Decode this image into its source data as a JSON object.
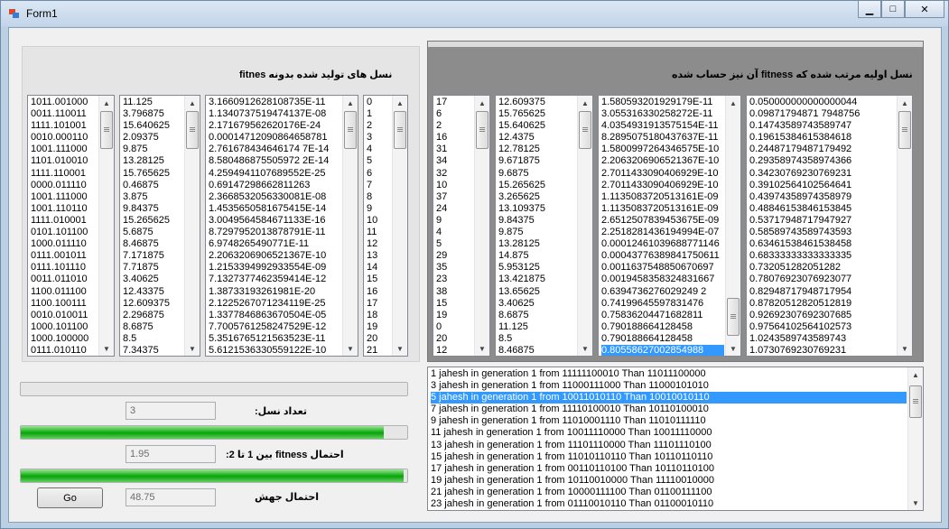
{
  "window": {
    "title": "Form1",
    "minimize_icon": "minimize-icon",
    "maximize_icon": "maximize-icon",
    "close_icon": "close-icon",
    "minimize_glyph": "▁",
    "maximize_glyph": "□",
    "close_glyph": "✕"
  },
  "left_panel": {
    "title": "نسل های تولید شده بدونه fitnes",
    "binaries": [
      "1011.001000",
      "0011.110011",
      "1111.101001",
      "0010.000110",
      "1001.111000",
      "1101.010010",
      "1111.110001",
      "0000.011110",
      "1001.111000",
      "1001.110110",
      "1111.010001",
      "0101.101100",
      "1000.011110",
      "0111.001011",
      "0111.101110",
      "0011.011010",
      "1100.011100",
      "1100.100111",
      "0010.010011",
      "1000.101100",
      "1000.100000",
      "0111.010110"
    ],
    "decimals": [
      "11.125",
      "3.796875",
      "15.640625",
      "2.09375",
      "9.875",
      "13.28125",
      "15.765625",
      "0.46875",
      "3.875",
      "9.84375",
      "15.265625",
      "5.6875",
      "8.46875",
      "7.171875",
      "7.71875",
      "3.40625",
      "12.43375",
      "12.609375",
      "2.296875",
      "8.6875",
      "8.5",
      "7.34375"
    ],
    "values": [
      "3.1660912628108735E-11",
      "1.1340737519474137E-08",
      "2.171679562620176E-24",
      "0.00014712090864658781",
      "2.761678434646174 7E-14",
      "8.580486875505972 2E-14",
      "4.2594941107689552E-25",
      "0.69147298662811263",
      "2.3668532056330081E-08",
      "1.4535650581675415E-14",
      "3.0049564584671133E-16",
      "8.7297952013878791E-11",
      "6.9748265490771E-11",
      "2.2063206906521367E-10",
      "1.2153394992933554E-09",
      "7.1327377462359414E-12",
      "1.38733193261981E-20",
      "2.1225267071234119E-25",
      "1.3377846863670504E-05",
      "7.7005761258247529E-12",
      "5.3516765121563523E-11",
      "5.6121536330559122E-10"
    ],
    "indices": [
      "0",
      "1",
      "2",
      "3",
      "4",
      "5",
      "6",
      "7",
      "8",
      "9",
      "10",
      "11",
      "12",
      "13",
      "14",
      "15",
      "16",
      "17",
      "18",
      "19",
      "20",
      "21"
    ]
  },
  "right_panel": {
    "title": "نسل اولیه مرتب شده که fitness آن نیز حساب شده",
    "indices": [
      "17",
      "6",
      "2",
      "16",
      "31",
      "34",
      "32",
      "10",
      "37",
      "24",
      "9",
      "4",
      "5",
      "29",
      "35",
      "23",
      "38",
      "15",
      "19",
      "0",
      "20",
      "12"
    ],
    "decimals": [
      "12.609375",
      "15.765625",
      "15.640625",
      "12.4375",
      "12.78125",
      "9.671875",
      "9.6875",
      "15.265625",
      "3.265625",
      "13.109375",
      "9.84375",
      "9.875",
      "13.28125",
      "14.875",
      "5.953125",
      "13.421875",
      "13.65625",
      "3.40625",
      "8.6875",
      "11.125",
      "8.5",
      "8.46875"
    ],
    "fitness": [
      "1.580593201929179E-11",
      "3.055316330258272E-11",
      "4.0354931913575154E-11",
      "8.2895075180437637E-11",
      "1.5800997264346575E-10",
      "2.2063206906521367E-10",
      "2.7011433090406929E-10",
      "2.7011433090406929E-10",
      "1.1135083720513161E-09",
      "1.1135083720513161E-09",
      "2.6512507839453675E-09",
      "2.2518281436194994E-07",
      "0.00012461039688771146",
      "0.00043776389841750611",
      "0.0011637548850670697",
      "0.0019458358324831667",
      "0.6394736276029249 2",
      "0.74199645597831476",
      "0.75836204471682811",
      "0.790188664128458",
      "0.790188664128458",
      "0.80558627002854988"
    ],
    "selected_fitness_index": 21,
    "cumulative": [
      "0.050000000000000044",
      "0.09871794871 7948756",
      "0.14743589743589747",
      "0.19615384615384618",
      "0.24487179487179492",
      "0.29358974358974366",
      "0.34230769230769231",
      "0.39102564102564641",
      "0.43974358974358979",
      "0.48846153846153845",
      "0.53717948717947927",
      "0.58589743589743593",
      "0.63461538461538458",
      "0.68333333333333335",
      "0.732051282051282",
      "0.78076923076923077",
      "0.82948717948717954",
      "0.87820512820512819",
      "0.92692307692307685",
      "0.97564102564102573",
      "1.0243589743589743",
      "1.0730769230769231"
    ]
  },
  "log": {
    "lines": [
      "1 jahesh in generation 1 from 11111100010 Than 11011100000",
      "3 jahesh in generation 1 from 11000111000 Than 11000101010",
      "5 jahesh in generation 1 from 10011010110 Than 10010010110",
      "7 jahesh in generation 1 from 11110100010 Than 10110100010",
      "9 jahesh in generation 1 from 11010001110 Than 11010111110",
      "11 jahesh in generation 1 from 10011110000 Than 10011110000",
      "13 jahesh in generation 1 from 11101110000 Than 11101110100",
      "15 jahesh in generation 1 from 11010110110 Than 10110110110",
      "17 jahesh in generation 1 from 00110110100 Than 10110110100",
      "19 jahesh in generation 1 from 10110010000 Than 11110010000",
      "21 jahesh in generation 1 from 10000111100 Than 01100111100",
      "23 jahesh in generation 1 from 01110010110 Than 01100010110"
    ],
    "selected_index": 2
  },
  "controls": {
    "progress_top": 0,
    "generations_label": "تعداد نسل:",
    "generations_value": "3",
    "progress_mid": 0.94,
    "fitness_label": "احتمال fitness بین 1 تا 2:",
    "fitness_value": "1.95",
    "progress_bottom": 0.99,
    "mutation_label": "احتمال جهش",
    "mutation_value": "48.75",
    "go_button": "Go"
  }
}
